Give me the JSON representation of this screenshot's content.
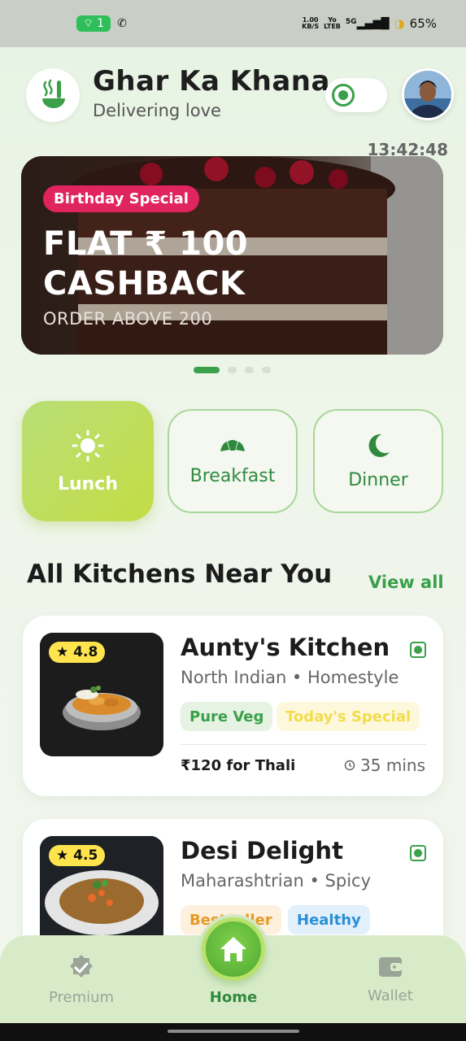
{
  "status_bar": {
    "time": "13:42:48",
    "hotspot_count": "1",
    "net_speed_top": "1.00",
    "net_speed_bottom": "KB/S",
    "volte_top": "Yo",
    "volte_bottom": "LTEB",
    "network": "5G",
    "battery": "65%"
  },
  "header": {
    "title": "Ghar Ka Khana",
    "subtitle": "Delivering love",
    "veg_toggle_on": true
  },
  "banner": {
    "badge": "Birthday Special",
    "title": "FLAT ₹ 100\nCASHBACK",
    "subtitle": "ORDER ABOVE 200",
    "active_slide": 1,
    "total_slides": 4
  },
  "meal_tabs": [
    {
      "label": "Lunch",
      "icon": "sun-icon",
      "active": true
    },
    {
      "label": "Breakfast",
      "icon": "croissant-icon",
      "active": false
    },
    {
      "label": "Dinner",
      "icon": "moon-icon",
      "active": false
    }
  ],
  "section": {
    "title": "All Kitchens Near You",
    "view_all": "View all"
  },
  "kitchens": [
    {
      "name": "Aunty's Kitchen",
      "rating": "★ 4.8",
      "cuisine": "North Indian • Homestyle",
      "tags": [
        "Pure Veg",
        "Today's Special"
      ],
      "price": "₹120 for Thali",
      "time": "35 mins"
    },
    {
      "name": "Desi Delight",
      "rating": "★ 4.5",
      "cuisine": "Maharashtrian • Spicy",
      "tags": [
        "Bestseller",
        "Healthy"
      ]
    }
  ],
  "bottom_nav": {
    "premium": "Premium",
    "home": "Home",
    "wallet": "Wallet",
    "active": "Home"
  },
  "colors": {
    "accent_green": "#3aa04a",
    "lime": "#c4dc45",
    "promo_pink": "#e0245e",
    "rating_yellow": "#ffe44d"
  }
}
